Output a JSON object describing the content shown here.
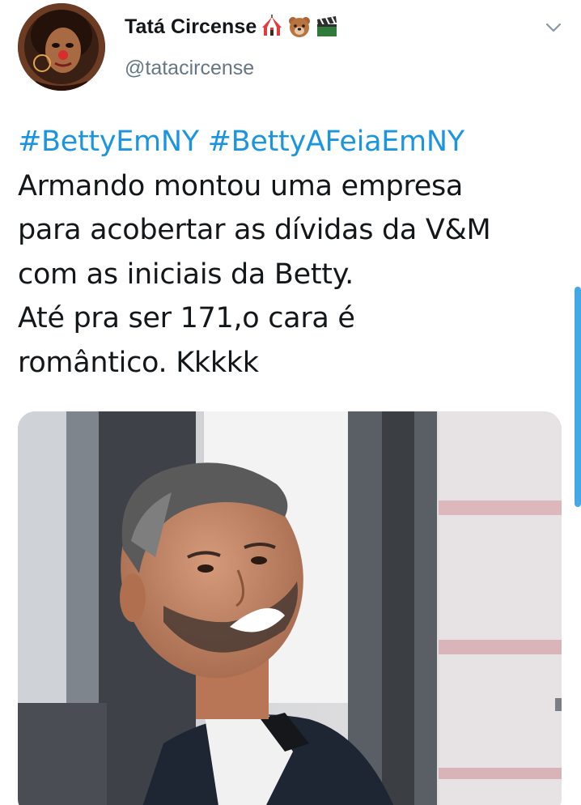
{
  "author": {
    "display_name": "Tatá Circense",
    "handle": "@tatacircense",
    "name_emojis": [
      "circus-tent-icon",
      "bear-face-icon",
      "clapper-board-icon"
    ]
  },
  "tweet": {
    "hashtags": [
      "#BettyEmNY",
      "#BettyAFeiaEmNY"
    ],
    "lines": [
      "Armando montou uma empresa",
      "para acobertar as dívidas da V&M",
      "com as iniciais da Betty.",
      "Até pra ser 171,o cara é",
      "romântico. Kkkkk"
    ]
  },
  "media": {
    "icon": "photo-of-smiling-man"
  },
  "colors": {
    "hashtag": "#1b95e0",
    "handle": "#657786",
    "text": "#14171a",
    "scrollbar": "#45a8e6"
  }
}
